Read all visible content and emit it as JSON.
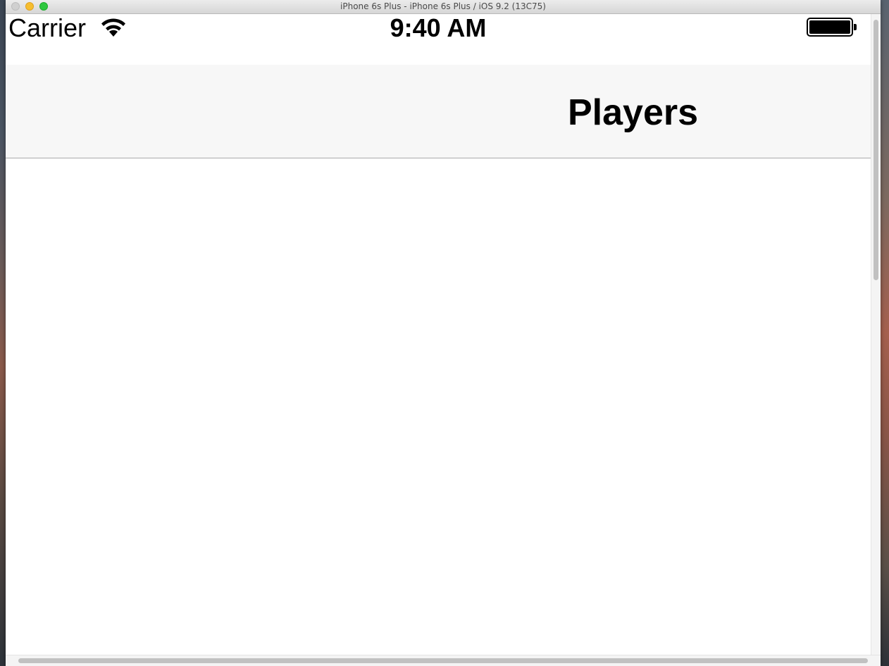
{
  "window": {
    "title": "iPhone 6s Plus - iPhone 6s Plus / iOS 9.2 (13C75)"
  },
  "status_bar": {
    "carrier": "Carrier",
    "wifi_icon": "wifi-icon",
    "time": "9:40 AM",
    "battery_icon": "battery-icon",
    "battery_level": 1.0
  },
  "nav_bar": {
    "title": "Players"
  },
  "colors": {
    "nav_background": "#f7f7f7",
    "nav_separator": "#a9a9ab",
    "text": "#000000",
    "close_button": "#d0d0d0",
    "minimize_button": "#f6be2f",
    "zoom_button": "#2ec83f"
  }
}
